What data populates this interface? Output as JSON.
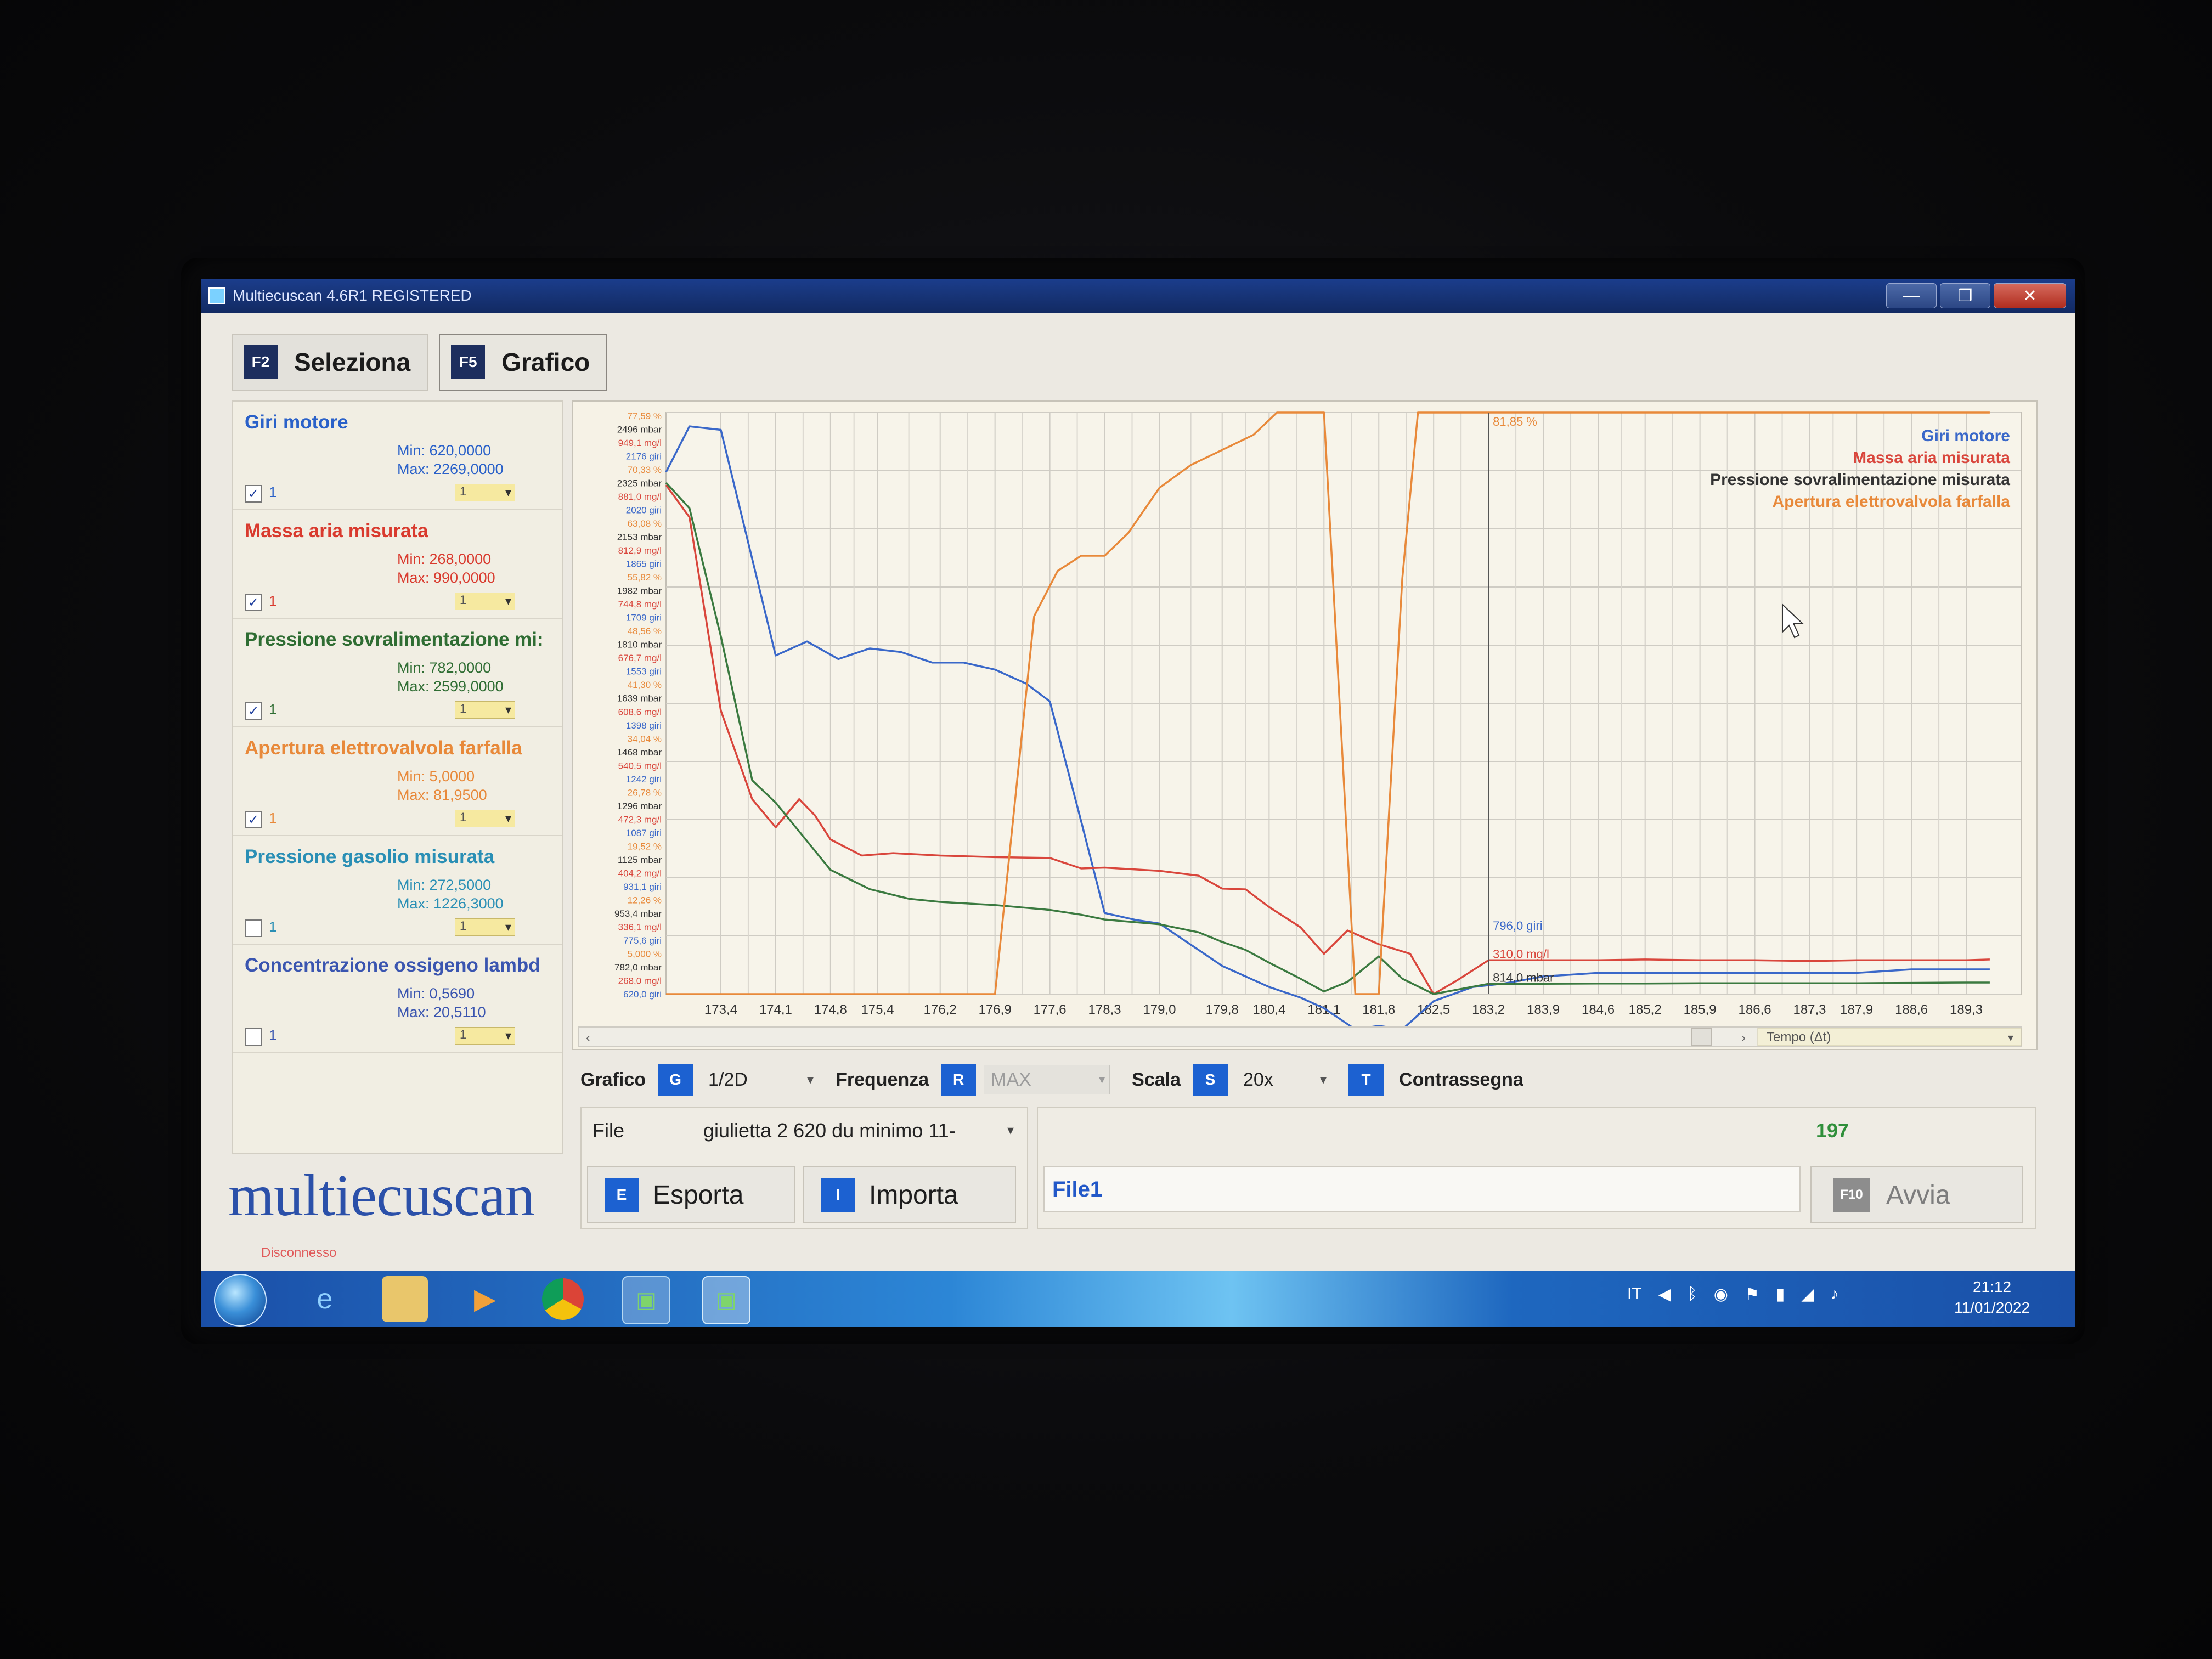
{
  "window": {
    "title": "Multiecuscan 4.6R1 REGISTERED"
  },
  "tabs": [
    {
      "key": "F2",
      "label": "Seleziona"
    },
    {
      "key": "F5",
      "label": "Grafico"
    }
  ],
  "params": [
    {
      "name": "Giri motore",
      "min": "Min: 620,0000",
      "max": "Max: 2269,0000",
      "checked": true,
      "index": "1",
      "dd": "1",
      "color": "#2a61c9"
    },
    {
      "name": "Massa aria misurata",
      "min": "Min: 268,0000",
      "max": "Max: 990,0000",
      "checked": true,
      "index": "1",
      "dd": "1",
      "color": "#d93a2e"
    },
    {
      "name": "Pressione sovralimentazione mi:",
      "min": "Min: 782,0000",
      "max": "Max: 2599,0000",
      "checked": true,
      "index": "1",
      "dd": "1",
      "color": "#2f6d33"
    },
    {
      "name": "Apertura elettrovalvola farfalla",
      "min": "Min: 5,0000",
      "max": "Max: 81,9500",
      "checked": true,
      "index": "1",
      "dd": "1",
      "color": "#e8893a"
    },
    {
      "name": "Pressione gasolio misurata",
      "min": "Min: 272,5000",
      "max": "Max: 1226,3000",
      "checked": false,
      "index": "1",
      "dd": "1",
      "color": "#2a8fb5"
    },
    {
      "name": "Concentrazione ossigeno lambd",
      "min": "Min: 0,5690",
      "max": "Max: 20,5110",
      "checked": false,
      "index": "1",
      "dd": "1",
      "color": "#3a55b0"
    }
  ],
  "logo": "multiecuscan",
  "status": "Disconnesso",
  "chart_data": {
    "type": "line",
    "xlabel": "Tempo (Δt)",
    "x_ticks": [
      "173,4",
      "174,1",
      "174,8",
      "175,4",
      "176,2",
      "176,9",
      "177,6",
      "178,3",
      "179,0",
      "179,8",
      "180,4",
      "181,1",
      "181,8",
      "182,5",
      "183,2",
      "183,9",
      "184,6",
      "185,2",
      "185,9",
      "186,6",
      "187,3",
      "187,9",
      "188,6",
      "189,3"
    ],
    "xlim": [
      172.7,
      190.0
    ],
    "legend": [
      "Giri motore",
      "Massa aria misurata",
      "Pressione sovralimentazione misurata",
      "Apertura elettrovalvola farfalla"
    ],
    "legend_position": "top-right",
    "grid": true,
    "series": [
      {
        "name": "Giri motore",
        "color": "#3a68c9",
        "ylim": [
          620,
          2269
        ],
        "x": [
          172.7,
          173.0,
          173.4,
          174.1,
          174.5,
          174.9,
          175.3,
          175.7,
          176.1,
          176.5,
          176.9,
          177.3,
          177.6,
          178.0,
          178.3,
          178.7,
          179.0,
          179.4,
          179.8,
          180.1,
          180.4,
          180.8,
          181.1,
          181.5,
          181.8,
          182.1,
          182.5,
          183.0,
          183.4,
          183.9,
          184.6,
          185.2,
          185.9,
          186.6,
          187.3,
          187.9,
          188.6,
          189.3,
          189.6
        ],
        "values": [
          2100,
          2230,
          2220,
          1580,
          1620,
          1570,
          1600,
          1590,
          1560,
          1560,
          1540,
          1500,
          1450,
          1110,
          850,
          830,
          820,
          760,
          700,
          670,
          640,
          610,
          580,
          520,
          530,
          520,
          600,
          640,
          650,
          670,
          680,
          680,
          680,
          680,
          680,
          680,
          690,
          690,
          690
        ]
      },
      {
        "name": "Massa aria misurata",
        "color": "#d9463c",
        "ylim": [
          268,
          990
        ],
        "x": [
          172.7,
          173.0,
          173.4,
          173.8,
          174.1,
          174.4,
          174.6,
          174.8,
          175.2,
          175.6,
          176.2,
          176.9,
          177.6,
          178.0,
          178.3,
          179.0,
          179.5,
          179.8,
          180.1,
          180.4,
          180.8,
          181.1,
          181.4,
          181.8,
          182.2,
          182.5,
          182.8,
          183.2,
          183.9,
          184.6,
          185.2,
          185.9,
          186.6,
          187.3,
          187.9,
          188.6,
          189.3,
          189.6
        ],
        "values": [
          900,
          860,
          620,
          510,
          475,
          510,
          490,
          460,
          440,
          443,
          440,
          438,
          437,
          424,
          425,
          421,
          415,
          399,
          398,
          376,
          351,
          318,
          347,
          330,
          318,
          268,
          285,
          310,
          310,
          310,
          311,
          310,
          310,
          309,
          310,
          310,
          310,
          311
        ]
      },
      {
        "name": "Pressione sovralimentazione misurata",
        "color": "#3b7a40",
        "ylim": [
          782,
          2599
        ],
        "x": [
          172.7,
          173.0,
          173.4,
          173.8,
          174.1,
          174.5,
          174.8,
          175.3,
          175.8,
          176.2,
          176.9,
          177.6,
          178.0,
          178.3,
          179.0,
          179.5,
          179.8,
          180.1,
          180.4,
          180.8,
          181.1,
          181.4,
          181.8,
          182.1,
          182.5,
          183.2,
          183.9,
          184.6,
          185.2,
          185.9,
          186.6,
          187.3,
          187.9,
          188.6,
          189.3,
          189.6
        ],
        "values": [
          2380,
          2300,
          1900,
          1450,
          1380,
          1260,
          1170,
          1110,
          1080,
          1070,
          1060,
          1045,
          1030,
          1015,
          1000,
          975,
          945,
          920,
          880,
          830,
          790,
          820,
          900,
          830,
          782,
          814,
          814,
          815,
          815,
          816,
          816,
          816,
          816,
          817,
          818,
          818
        ]
      },
      {
        "name": "Apertura elettrovalvola farfalla",
        "color": "#e8893a",
        "ylim": [
          5.0,
          81.95
        ],
        "x": [
          172.7,
          176.9,
          177.4,
          177.7,
          178.0,
          178.3,
          178.6,
          179.0,
          179.4,
          179.8,
          180.2,
          180.5,
          180.9,
          181.1,
          181.5,
          181.8,
          182.1,
          182.3,
          182.5,
          182.8,
          183.2,
          183.9,
          184.6,
          185.2,
          185.9,
          186.6,
          187.3,
          187.9,
          188.6,
          189.3,
          189.6
        ],
        "values": [
          5,
          5,
          55,
          61,
          63,
          63,
          66,
          72,
          75,
          77,
          79,
          81.95,
          81.95,
          81.95,
          5,
          5,
          60,
          81.95,
          81.95,
          81.95,
          81.95,
          81.95,
          81.95,
          81.95,
          81.95,
          81.95,
          81.95,
          81.95,
          81.95,
          81.95,
          81.95
        ]
      }
    ],
    "y_labels": [
      {
        "text": "77,59 %",
        "color": "#e8893a"
      },
      {
        "text": "2496 mbar",
        "color": "#333333"
      },
      {
        "text": "949,1 mg/l",
        "color": "#d9463c"
      },
      {
        "text": "2176 giri",
        "color": "#3a68c9"
      },
      {
        "text": "70,33 %",
        "color": "#e8893a"
      },
      {
        "text": "2325 mbar",
        "color": "#333333"
      },
      {
        "text": "881,0 mg/l",
        "color": "#d9463c"
      },
      {
        "text": "2020 giri",
        "color": "#3a68c9"
      },
      {
        "text": "63,08 %",
        "color": "#e8893a"
      },
      {
        "text": "2153 mbar",
        "color": "#333333"
      },
      {
        "text": "812,9 mg/l",
        "color": "#d9463c"
      },
      {
        "text": "1865 giri",
        "color": "#3a68c9"
      },
      {
        "text": "55,82 %",
        "color": "#e8893a"
      },
      {
        "text": "1982 mbar",
        "color": "#333333"
      },
      {
        "text": "744,8 mg/l",
        "color": "#d9463c"
      },
      {
        "text": "1709 giri",
        "color": "#3a68c9"
      },
      {
        "text": "48,56 %",
        "color": "#e8893a"
      },
      {
        "text": "1810 mbar",
        "color": "#333333"
      },
      {
        "text": "676,7 mg/l",
        "color": "#d9463c"
      },
      {
        "text": "1553 giri",
        "color": "#3a68c9"
      },
      {
        "text": "41,30 %",
        "color": "#e8893a"
      },
      {
        "text": "1639 mbar",
        "color": "#333333"
      },
      {
        "text": "608,6 mg/l",
        "color": "#d9463c"
      },
      {
        "text": "1398 giri",
        "color": "#3a68c9"
      },
      {
        "text": "34,04 %",
        "color": "#e8893a"
      },
      {
        "text": "1468 mbar",
        "color": "#333333"
      },
      {
        "text": "540,5 mg/l",
        "color": "#d9463c"
      },
      {
        "text": "1242 giri",
        "color": "#3a68c9"
      },
      {
        "text": "26,78 %",
        "color": "#e8893a"
      },
      {
        "text": "1296 mbar",
        "color": "#333333"
      },
      {
        "text": "472,3 mg/l",
        "color": "#d9463c"
      },
      {
        "text": "1087 giri",
        "color": "#3a68c9"
      },
      {
        "text": "19,52 %",
        "color": "#e8893a"
      },
      {
        "text": "1125 mbar",
        "color": "#333333"
      },
      {
        "text": "404,2 mg/l",
        "color": "#d9463c"
      },
      {
        "text": "931,1 giri",
        "color": "#3a68c9"
      },
      {
        "text": "12,26 %",
        "color": "#e8893a"
      },
      {
        "text": "953,4 mbar",
        "color": "#333333"
      },
      {
        "text": "336,1 mg/l",
        "color": "#d9463c"
      },
      {
        "text": "775,6 giri",
        "color": "#3a68c9"
      },
      {
        "text": "5,000 %",
        "color": "#e8893a"
      },
      {
        "text": "782,0 mbar",
        "color": "#333333"
      },
      {
        "text": "268,0 mg/l",
        "color": "#d9463c"
      },
      {
        "text": "620,0 giri",
        "color": "#3a68c9"
      }
    ],
    "cursor": {
      "x": 183.2,
      "labels": [
        {
          "text": "81,85 %",
          "color": "#e8893a",
          "series": 3,
          "value": 81.95
        },
        {
          "text": "796,0 giri",
          "color": "#3a68c9",
          "series": 0,
          "value": 796
        },
        {
          "text": "310,0 mg/l",
          "color": "#d9463c",
          "series": 1,
          "value": 310
        },
        {
          "text": "814,0 mbar",
          "color": "#333333",
          "series": 2,
          "value": 814
        }
      ]
    }
  },
  "controls": {
    "grafico_label": "Grafico",
    "grafico_key": "G",
    "grafico_value": "1/2D",
    "frequenza_label": "Frequenza",
    "frequenza_key": "R",
    "frequenza_value": "MAX",
    "scala_label": "Scala",
    "scala_key": "S",
    "scala_value": "20x",
    "contrassegna_key": "T",
    "contrassegna_label": "Contrassegna"
  },
  "file": {
    "label": "File",
    "value": "giulietta 2 620 du minimo 11-"
  },
  "buttons": {
    "esporta_key": "E",
    "esporta": "Esporta",
    "importa_key": "I",
    "importa": "Importa",
    "avvia_key": "F10",
    "avvia": "Avvia"
  },
  "counter": "197",
  "file_name": "File1",
  "taskbar": {
    "lang": "IT",
    "time": "21:12",
    "date": "11/01/2022"
  }
}
